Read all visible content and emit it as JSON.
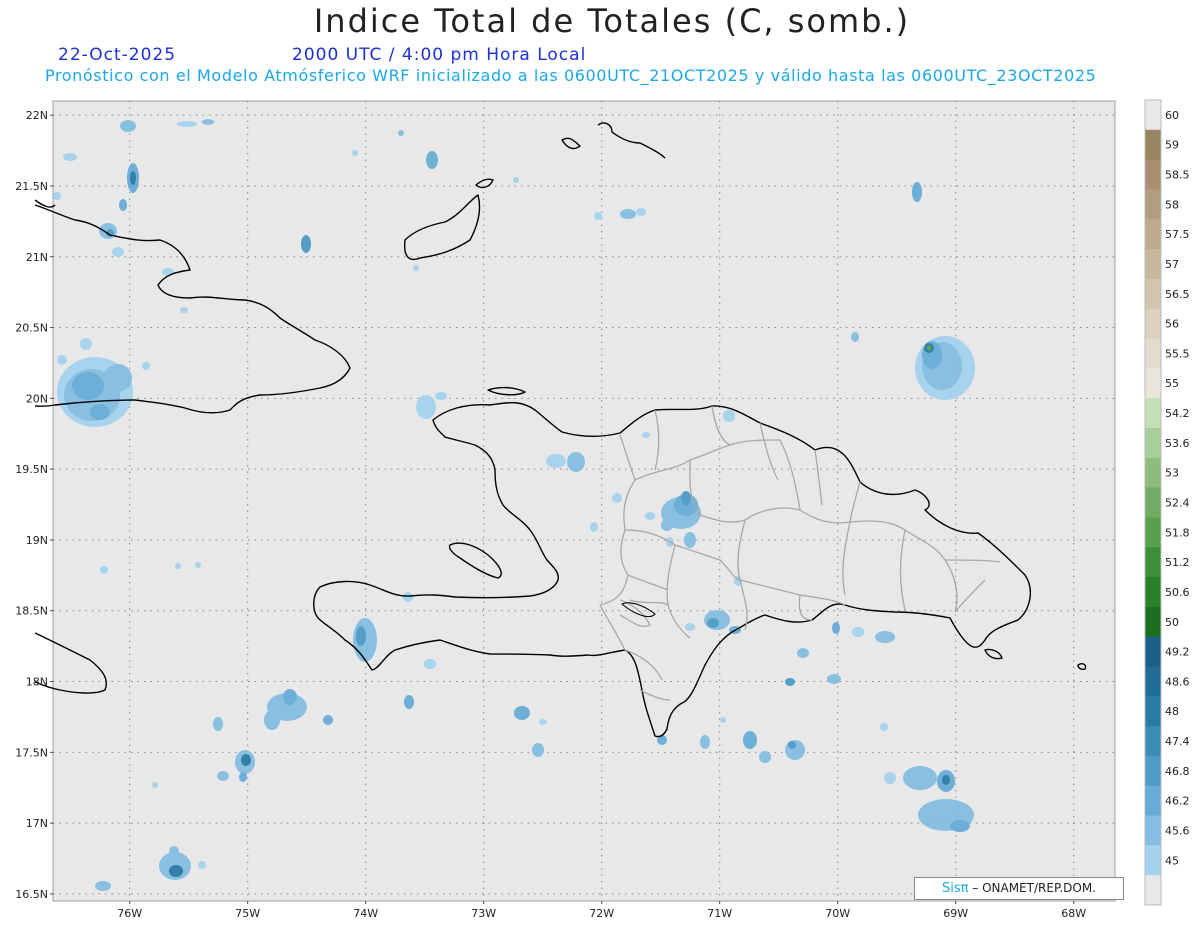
{
  "header": {
    "title": "Indice Total de Totales (C, somb.)",
    "date": "22-Oct-2025",
    "time": "2000 UTC / 4:00 pm Hora Local",
    "subtitle": "Pronóstico con el Modelo Atmósferico WRF inicializado a las 0600UTC_21OCT2025 y válido hasta las  0600UTC_23OCT2025"
  },
  "credit": {
    "logo": "Sisπ",
    "text": "– ONAMET/REP.DOM."
  },
  "map": {
    "lon_range": [
      -76.65,
      -67.65
    ],
    "lat_range": [
      16.45,
      22.1
    ],
    "lat_ticks": [
      "22N",
      "21.5N",
      "21N",
      "20.5N",
      "20N",
      "19.5N",
      "19N",
      "18.5N",
      "18N",
      "17.5N",
      "17N",
      "16.5N"
    ],
    "lat_tick_values": [
      22,
      21.5,
      21,
      20.5,
      20,
      19.5,
      19,
      18.5,
      18,
      17.5,
      17,
      16.5
    ],
    "lon_ticks": [
      "76W",
      "75W",
      "74W",
      "73W",
      "72W",
      "71W",
      "70W",
      "69W",
      "68W"
    ],
    "lon_tick_values": [
      -76,
      -75,
      -74,
      -73,
      -72,
      -71,
      -70,
      -69,
      -68
    ],
    "background_color": "#e8e8e8",
    "coast_color": "#000000",
    "province_border_color": "#a8a8a8"
  },
  "colorbar": {
    "labels": [
      "60",
      "59",
      "58.5",
      "58",
      "57.5",
      "57",
      "56.5",
      "56",
      "55.5",
      "55",
      "54.2",
      "53.6",
      "53",
      "52.4",
      "51.8",
      "51.2",
      "50.6",
      "50",
      "49.2",
      "48.6",
      "48",
      "47.4",
      "46.8",
      "46.2",
      "45.6",
      "45"
    ],
    "colors": [
      "#e8e8e8",
      "#9b8462",
      "#a99070",
      "#b49d7f",
      "#bea98c",
      "#c9b79b",
      "#d3c5ad",
      "#dbd1be",
      "#e3dbcf",
      "#ebe6dc",
      "#c4e0b9",
      "#a8cf99",
      "#8dbd7d",
      "#70ad62",
      "#58a04c",
      "#3f8f38",
      "#2b802a",
      "#1c6d1c",
      "#1a5f85",
      "#216d96",
      "#2a7ba6",
      "#3a8bb6",
      "#4d9bc6",
      "#67acd6",
      "#84bee2",
      "#a4d2ef",
      "#e8e8e8"
    ]
  }
}
